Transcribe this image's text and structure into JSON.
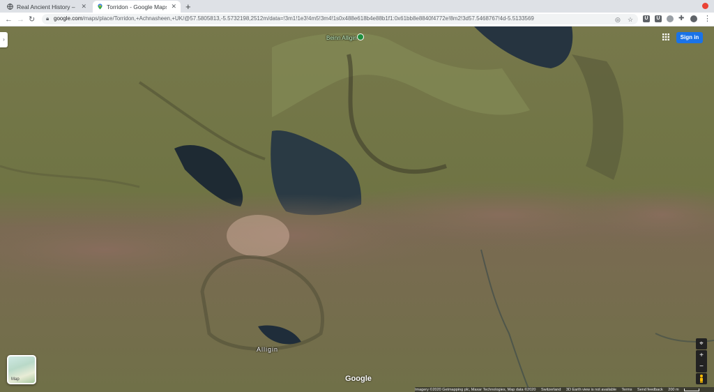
{
  "tabs": [
    {
      "title": "Real Ancient History – Ex",
      "favicon": "globe-icon",
      "active": false
    },
    {
      "title": "Torridon - Google Maps",
      "favicon": "maps-pin-icon",
      "active": true
    }
  ],
  "toolbar": {
    "url_host": "google.com",
    "url_rest": "/maps/place/Torridon,+Achnasheen,+UK/@57.5805813,-5.5732198,2512m/data=!3m1!1e3!4m5!3m4!1s0x488e618b4e88b1f1:0x61bb8e8840f4772e!8m2!3d57.5468767!4d-5.5133569"
  },
  "map": {
    "sign_in_label": "Sign in",
    "poi_label": "Beinn Alligin",
    "place_label": "Alligin",
    "layer_label": "Map",
    "google_logo": "Google",
    "zoom_in": "+",
    "zoom_out": "−",
    "footer": {
      "imagery": "Imagery ©2020 Getmapping plc, Maxar Technologies, Map data ©2020",
      "country": "Switzerland",
      "earth": "3D Earth view is not available",
      "terms": "Terms",
      "feedback": "Send feedback",
      "scale": "200 m"
    }
  },
  "colors": {
    "accent": "#1a73e8",
    "record": "#ea4335"
  }
}
